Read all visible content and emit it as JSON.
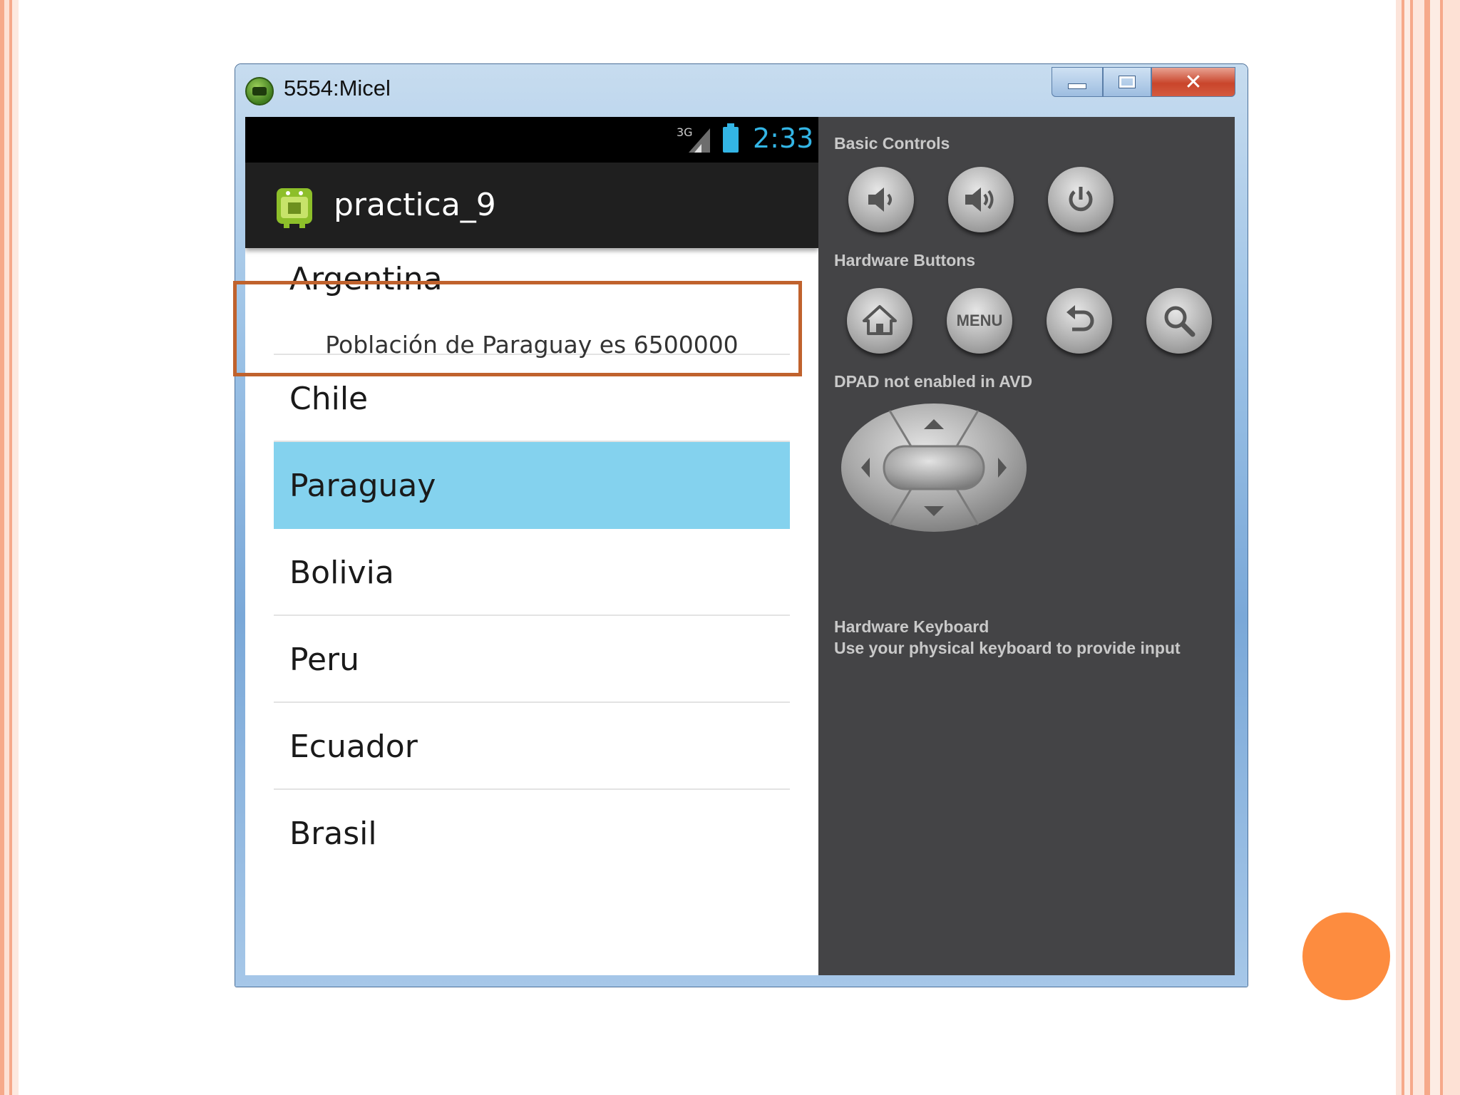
{
  "window": {
    "title": "5554:Micel"
  },
  "status_bar": {
    "network": "3G",
    "time": "2:33"
  },
  "app": {
    "title": "practica_9"
  },
  "toast": "Población de Paraguay es 6500000",
  "countries": [
    {
      "label": "Argentina",
      "selected": false
    },
    {
      "label": "Chile",
      "selected": false
    },
    {
      "label": "Paraguay",
      "selected": true
    },
    {
      "label": "Bolivia",
      "selected": false
    },
    {
      "label": "Peru",
      "selected": false
    },
    {
      "label": "Ecuador",
      "selected": false
    },
    {
      "label": "Brasil",
      "selected": false
    }
  ],
  "controls": {
    "basic_label": "Basic Controls",
    "hardware_label": "Hardware Buttons",
    "menu_label": "MENU",
    "dpad_label": "DPAD not enabled in AVD",
    "keyboard_label": "Hardware Keyboard",
    "keyboard_hint": "Use your physical keyboard to provide input"
  },
  "colors": {
    "accent": "#33b5e5",
    "selection": "#84d2ee",
    "highlight_border": "#c0622d"
  }
}
